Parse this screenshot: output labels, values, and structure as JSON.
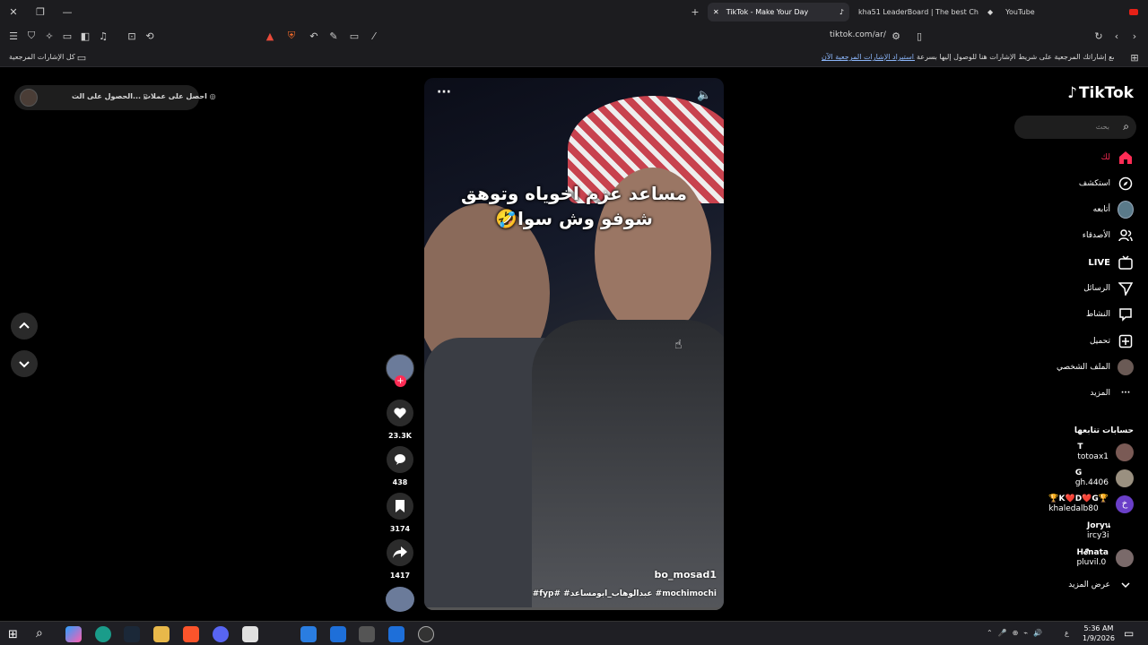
{
  "browser": {
    "tabs": [
      {
        "title": "TikTok - Make Your Day",
        "active": true
      },
      {
        "title": "kha51 LeaderBoard | The best ChatB..."
      },
      {
        "title": "YouTube"
      }
    ],
    "url": "tiktok.com/ar/",
    "bookmarks_hint": "ضع إشاراتك المرجعية على شريط الإشارات هنا للوصول إليها بسرعة.",
    "bookmarks_import": "استيراد الإشارات المرجعية الآن...",
    "all_bookmarks": "كل الإشارات المرجعية"
  },
  "promo": {
    "get_coins": "احصل على عملات",
    "get_app": "الحصول على الت..."
  },
  "tiktok": {
    "logo": "TikTok",
    "search_placeholder": "بحث",
    "nav": [
      {
        "label": "لك",
        "icon": "home-icon"
      },
      {
        "label": "استكشف",
        "icon": "compass-icon"
      },
      {
        "label": "أتابعه",
        "icon": "avatar-icon"
      },
      {
        "label": "الأصدقاء",
        "icon": "friends-icon"
      },
      {
        "label": "LIVE",
        "icon": "live-icon"
      },
      {
        "label": "الرسائل",
        "icon": "send-icon"
      },
      {
        "label": "النشاط",
        "icon": "message-icon"
      },
      {
        "label": "تحميل",
        "icon": "upload-icon"
      },
      {
        "label": "الملف الشخصي",
        "icon": "profile-icon"
      },
      {
        "label": "المزيد",
        "icon": "more-icon"
      }
    ],
    "following_heading": "حسابات تتابعها",
    "following": [
      {
        "display": "T",
        "handle": "totoax1"
      },
      {
        "display": "G",
        "handle": "gh.4406"
      },
      {
        "display": "🏆K❤️D❤️G🏆",
        "handle": "khaledalb80"
      },
      {
        "display": "Joryน",
        "handle": "ircy3i"
      },
      {
        "display": "H𝓔nata",
        "handle": "pluvil.0"
      }
    ],
    "see_more": "عرض المزيد"
  },
  "video": {
    "caption_line1": "مساعد عزم اخوياه وتوهق",
    "caption_line2": "شوفو وش سوا🤣",
    "author": "bo_mosad1",
    "hashtags": "#fyp# #عبدالوهاب_ابومساعد #mochimochi",
    "likes": "23.3K",
    "comments": "438",
    "saves": "3174",
    "shares": "1417"
  },
  "taskbar": {
    "time": "5:36 AM",
    "date": "1/9/2026",
    "lang": "ع"
  }
}
